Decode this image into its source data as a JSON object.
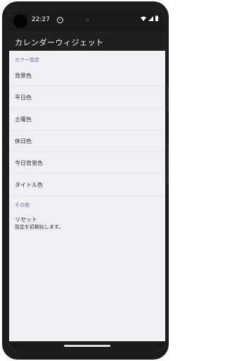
{
  "status_bar": {
    "time": "22:27",
    "notification_icon": "dnd-icon",
    "icons": [
      "wifi-icon",
      "signal-icon",
      "battery-icon"
    ]
  },
  "app_bar": {
    "title": "カレンダーウィジェット"
  },
  "sections": {
    "color": {
      "header": "カラー設定",
      "items": [
        {
          "label": "背景色"
        },
        {
          "label": "平日色"
        },
        {
          "label": "土曜色"
        },
        {
          "label": "休日色"
        },
        {
          "label": "今日背景色"
        },
        {
          "label": "タイトル色"
        }
      ]
    },
    "other": {
      "header": "その他",
      "reset": {
        "title": "リセット",
        "summary": "設定を初期化します。"
      }
    }
  },
  "colors": {
    "accent_category": "#6a6ea8",
    "app_bar": "#1f1f1f",
    "background": "#f1eff4"
  }
}
